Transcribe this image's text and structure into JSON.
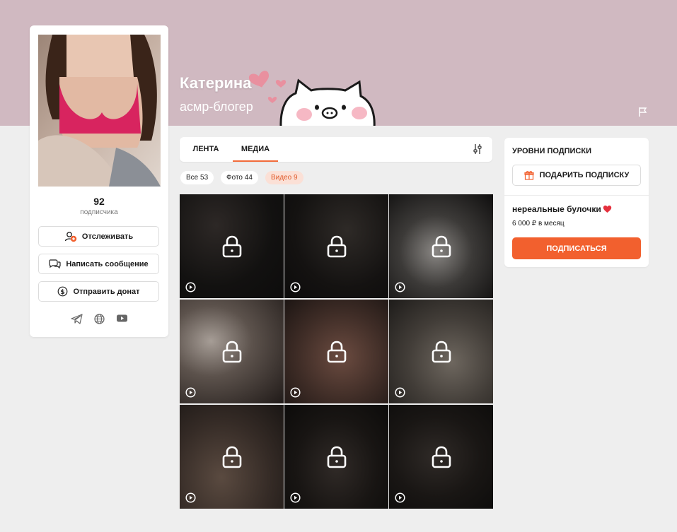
{
  "banner": {
    "title": "Катерина",
    "subtitle": "асмр-блогер",
    "background_color": "#d0b9c1"
  },
  "profile": {
    "subscriber_count": "92",
    "subscriber_label": "подписчика",
    "buttons": {
      "follow": "Отслеживать",
      "message": "Написать сообщение",
      "donate": "Отправить донат"
    },
    "socials": [
      "telegram-icon",
      "globe-icon",
      "youtube-icon"
    ]
  },
  "tabs": [
    {
      "label": "ЛЕНТА",
      "active": false
    },
    {
      "label": "МЕДИА",
      "active": true
    }
  ],
  "filters": [
    {
      "label": "Все 53",
      "active": false
    },
    {
      "label": "Фото 44",
      "active": false
    },
    {
      "label": "Видео 9",
      "active": true
    }
  ],
  "media": {
    "count": 9,
    "type": "video",
    "locked": true
  },
  "subscription": {
    "title": "УРОВНИ ПОДПИСКИ",
    "gift_label": "ПОДАРИТЬ ПОДПИСКУ",
    "tier_name": "нереальные булочки",
    "tier_price": "6 000 ₽ в месяц",
    "subscribe_label": "ПОДПИСАТЬСЯ"
  },
  "colors": {
    "accent": "#f2602e",
    "page_bg": "#eeeeee"
  }
}
